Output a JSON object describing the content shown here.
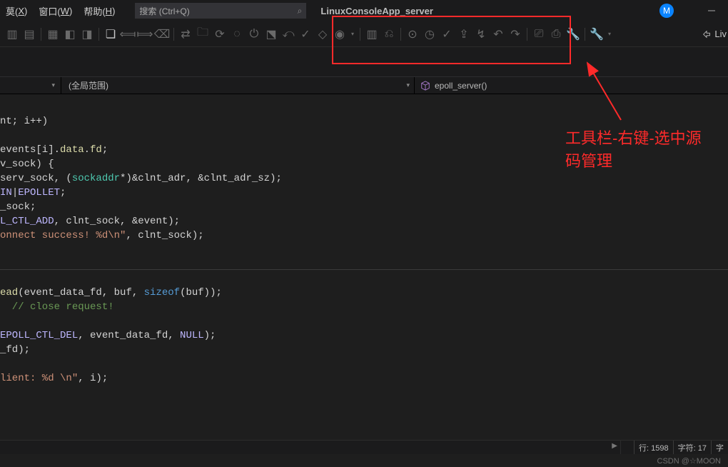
{
  "menu": {
    "items": [
      {
        "pre": "",
        "u": "X",
        "post": ")",
        "l": "莫("
      },
      {
        "pre": "窗口(",
        "u": "W",
        "post": ")"
      },
      {
        "pre": "帮助(",
        "u": "H",
        "post": ")"
      }
    ],
    "search_placeholder": "搜索 (Ctrl+Q)",
    "title": "LinuxConsoleApp_server",
    "avatar_letter": "M"
  },
  "toolbar": {
    "live_label": "Liv"
  },
  "scope": {
    "global": "(全局范围)",
    "func": "epoll_server()"
  },
  "code": {
    "l1": [
      "nt; i++)"
    ],
    "l2": [
      "events[i].",
      "data",
      ".",
      "fd",
      ";"
    ],
    "l3": [
      "v_sock) {"
    ],
    "l4": [
      "serv_sock, (",
      "sockaddr",
      "*)&clnt_adr, &clnt_adr_sz);"
    ],
    "l5": [
      "IN",
      "|",
      "EPOLLET",
      ";"
    ],
    "l6": [
      "_sock;"
    ],
    "l7": [
      "L_CTL_ADD",
      ", clnt_sock, &event);"
    ],
    "l8": [
      "onnect success! %d\\n\"",
      ", clnt_sock);"
    ],
    "l9": [
      "ead",
      "(event_data_fd, buf, ",
      "sizeof",
      "(buf));"
    ],
    "l10": [
      "  // close request!"
    ],
    "l11": [
      "EPOLL_CTL_DEL",
      ", event_data_fd, ",
      "NULL",
      ");"
    ],
    "l12": [
      "_fd);"
    ],
    "l13": [
      "lient: %d \\n\"",
      ", i);"
    ]
  },
  "status": {
    "line": "行: 1598",
    "chars": "字符: 17",
    "extra": "字"
  },
  "watermark": "CSDN @☆MOON",
  "annotation": {
    "text": "工具栏-右键-选中源码管理"
  }
}
